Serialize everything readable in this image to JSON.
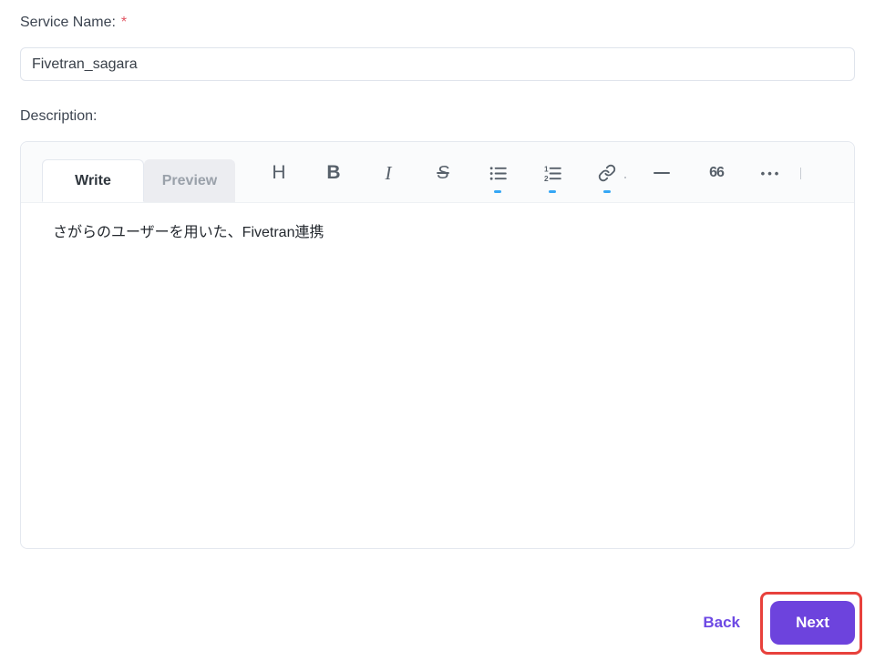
{
  "form": {
    "service_name": {
      "label": "Service Name:",
      "required_mark": "*",
      "value": "Fivetran_sagara"
    },
    "description": {
      "label": "Description:"
    }
  },
  "editor": {
    "tabs": [
      {
        "label": "Write",
        "active": true
      },
      {
        "label": "Preview",
        "active": false
      }
    ],
    "toolbar": {
      "heading": "H",
      "bold": "B",
      "italic": "I",
      "strikethrough": "S",
      "quote": "66",
      "more": "•••",
      "icons": [
        "heading-icon",
        "bold-icon",
        "italic-icon",
        "strikethrough-icon",
        "bullet-list-icon",
        "numbered-list-icon",
        "link-icon",
        "horizontal-rule-icon",
        "quote-icon",
        "more-icon"
      ]
    },
    "content": "さがらのユーザーを用いた、Fivetran連携"
  },
  "footer": {
    "back_label": "Back",
    "next_label": "Next"
  },
  "colors": {
    "accent_purple": "#6d43dd",
    "link_purple": "#6d49e4",
    "annotation_red": "#e8413c",
    "required_red": "#e25563",
    "toolbar_icon_gray": "#57606a",
    "badge_blue": "#36a7f5"
  }
}
